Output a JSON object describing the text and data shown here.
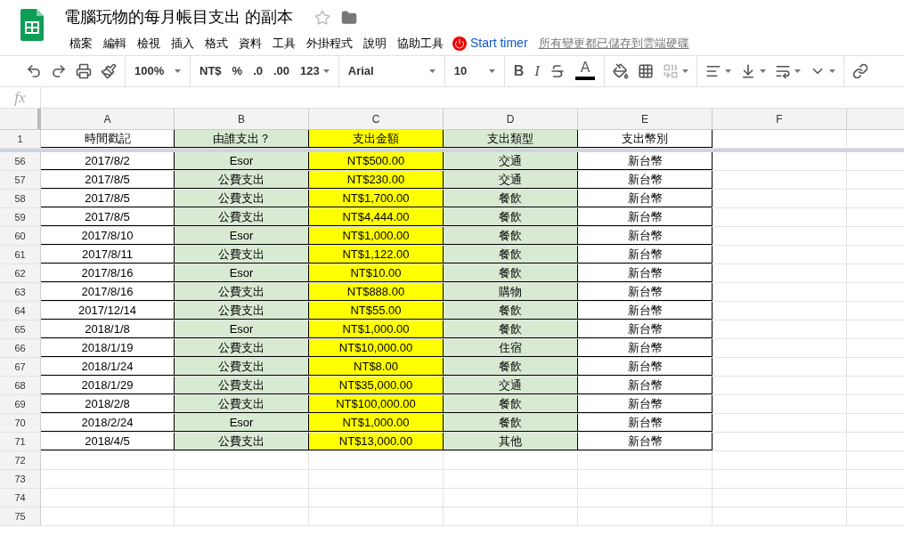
{
  "document": {
    "title": "電腦玩物的每月帳目支出 的副本",
    "starred": false
  },
  "menu": [
    "檔案",
    "編輯",
    "檢視",
    "插入",
    "格式",
    "資料",
    "工具",
    "外掛程式",
    "說明",
    "協助工具"
  ],
  "timer_button": "Start timer",
  "save_status": "所有變更都已儲存到雲端硬碟",
  "toolbar": {
    "zoom": "100%",
    "currency": "NT$",
    "percent": "%",
    "decrease_decimals": ".0",
    "increase_decimals": ".00",
    "number_format": "123",
    "font": "Arial",
    "font_size": "10",
    "bold": "B",
    "italic": "I",
    "text_color": "A"
  },
  "formula_bar": {
    "label": "fx"
  },
  "columns": [
    {
      "letter": "A",
      "header": "時間戳記",
      "color": "#ffffff"
    },
    {
      "letter": "B",
      "header": "由誰支出？",
      "color": "#d9ead3"
    },
    {
      "letter": "C",
      "header": "支出金額",
      "color": "#ffff00"
    },
    {
      "letter": "D",
      "header": "支出類型",
      "color": "#d9ead3"
    },
    {
      "letter": "E",
      "header": "支出幣別",
      "color": "#ffffff"
    },
    {
      "letter": "F"
    }
  ],
  "header_row": "1",
  "rows": [
    {
      "number": "56",
      "cells": [
        "2017/8/2",
        "Esor",
        "NT$500.00",
        "交通",
        "新台幣"
      ]
    },
    {
      "number": "57",
      "cells": [
        "2017/8/5",
        "公費支出",
        "NT$230.00",
        "交通",
        "新台幣"
      ]
    },
    {
      "number": "58",
      "cells": [
        "2017/8/5",
        "公費支出",
        "NT$1,700.00",
        "餐飲",
        "新台幣"
      ]
    },
    {
      "number": "59",
      "cells": [
        "2017/8/5",
        "公費支出",
        "NT$4,444.00",
        "餐飲",
        "新台幣"
      ]
    },
    {
      "number": "60",
      "cells": [
        "2017/8/10",
        "Esor",
        "NT$1,000.00",
        "餐飲",
        "新台幣"
      ]
    },
    {
      "number": "61",
      "cells": [
        "2017/8/11",
        "公費支出",
        "NT$1,122.00",
        "餐飲",
        "新台幣"
      ]
    },
    {
      "number": "62",
      "cells": [
        "2017/8/16",
        "Esor",
        "NT$10.00",
        "餐飲",
        "新台幣"
      ]
    },
    {
      "number": "63",
      "cells": [
        "2017/8/16",
        "公費支出",
        "NT$888.00",
        "購物",
        "新台幣"
      ]
    },
    {
      "number": "64",
      "cells": [
        "2017/12/14",
        "公費支出",
        "NT$55.00",
        "餐飲",
        "新台幣"
      ]
    },
    {
      "number": "65",
      "cells": [
        "2018/1/8",
        "Esor",
        "NT$1,000.00",
        "餐飲",
        "新台幣"
      ]
    },
    {
      "number": "66",
      "cells": [
        "2018/1/19",
        "公費支出",
        "NT$10,000.00",
        "住宿",
        "新台幣"
      ]
    },
    {
      "number": "67",
      "cells": [
        "2018/1/24",
        "公費支出",
        "NT$8.00",
        "餐飲",
        "新台幣"
      ]
    },
    {
      "number": "68",
      "cells": [
        "2018/1/29",
        "公費支出",
        "NT$35,000.00",
        "交通",
        "新台幣"
      ]
    },
    {
      "number": "69",
      "cells": [
        "2018/2/8",
        "公費支出",
        "NT$100,000.00",
        "餐飲",
        "新台幣"
      ]
    },
    {
      "number": "70",
      "cells": [
        "2018/2/24",
        "Esor",
        "NT$1,000.00",
        "餐飲",
        "新台幣"
      ]
    },
    {
      "number": "71",
      "cells": [
        "2018/4/5",
        "公費支出",
        "NT$13,000.00",
        "其他",
        "新台幣"
      ]
    },
    {
      "number": "72"
    },
    {
      "number": "73"
    },
    {
      "number": "74"
    },
    {
      "number": "75"
    }
  ]
}
